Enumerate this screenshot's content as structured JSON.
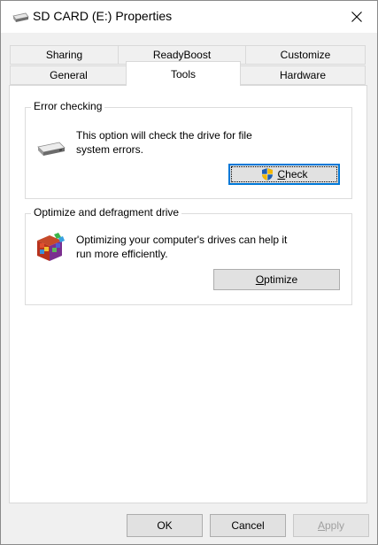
{
  "window": {
    "title": "SD CARD (E:) Properties",
    "close_icon": "close-icon"
  },
  "tabs": {
    "row1": [
      {
        "label": "Sharing"
      },
      {
        "label": "ReadyBoost"
      },
      {
        "label": "Customize"
      }
    ],
    "row2": [
      {
        "label": "General"
      },
      {
        "label": "Tools",
        "active": true
      },
      {
        "label": "Hardware"
      }
    ]
  },
  "error_checking": {
    "group_label": "Error checking",
    "icon": "drive-icon",
    "description": "This option will check the drive for file system errors.",
    "button": {
      "mnemonic": "C",
      "rest": "heck",
      "icon": "uac-shield-icon"
    }
  },
  "optimize": {
    "group_label": "Optimize and defragment drive",
    "icon": "defrag-icon",
    "description": "Optimizing your computer's drives can help it run more efficiently.",
    "button": {
      "mnemonic": "O",
      "rest": "ptimize"
    }
  },
  "footer": {
    "ok_label": "OK",
    "cancel_label": "Cancel",
    "apply_mnemonic": "A",
    "apply_rest": "pply"
  },
  "colors": {
    "accent": "#0078d7",
    "window_bg": "#f0f0f0",
    "panel_bg": "#ffffff",
    "disabled_text": "#a0a0a0"
  }
}
